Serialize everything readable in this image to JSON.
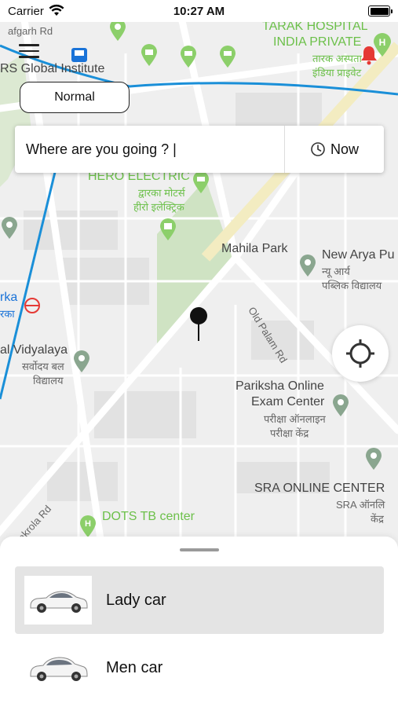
{
  "status_bar": {
    "carrier": "Carrier",
    "time": "10:27 AM"
  },
  "map": {
    "labels": {
      "tarak_hospital": "TARAK HOSPITAL",
      "india_private": "INDIA PRIVATE",
      "tarak_hindi_1": "तारक अस्पता",
      "tarak_hindi_2": "इंडिया प्राइवेट",
      "garh_rd": "afgarh Rd",
      "rs_global": "RS Global Institute",
      "hero_electric": "HERO ELECTRIC",
      "hero_hindi_1": "द्वारका मोटर्स",
      "hero_hindi_2": "हीरो इलेक्ट्रिक",
      "mahila_park": "Mahila Park",
      "new_arya": "New Arya Pu",
      "new_arya_hindi_1": "न्यू आर्य",
      "new_arya_hindi_2": "पब्लिक विद्यालय",
      "old_palam_rd": "Old Palam Rd",
      "rka": "rka",
      "rka_hindi": "रका",
      "vidyalaya": "al Vidyalaya",
      "vidyalaya_hindi_1": "सर्वोदय बल",
      "vidyalaya_hindi_2": "विद्यालय",
      "pariksha_1": "Pariksha Online",
      "pariksha_2": "Exam Center",
      "pariksha_hindi_1": "परीक्षा ऑनलाइन",
      "pariksha_hindi_2": "परीक्षा केंद्र",
      "sra": "SRA ONLINE CENTER",
      "sra_hindi_1": "SRA ऑनलि",
      "sra_hindi_2": "केंद्र",
      "kakrola_rd": "Kakrola Rd",
      "dots_tb": "DOTS TB center"
    }
  },
  "controls": {
    "mode": "Normal",
    "search_placeholder": "Where are you going ? |",
    "time_label": "Now"
  },
  "cars": [
    {
      "label": "Lady car",
      "selected": true
    },
    {
      "label": "Men car",
      "selected": false
    }
  ],
  "colors": {
    "accent_green": "#6cc04a",
    "route_blue": "#1a8fd8",
    "bell_red": "#e53935",
    "selected_bg": "#e4e4e4"
  }
}
